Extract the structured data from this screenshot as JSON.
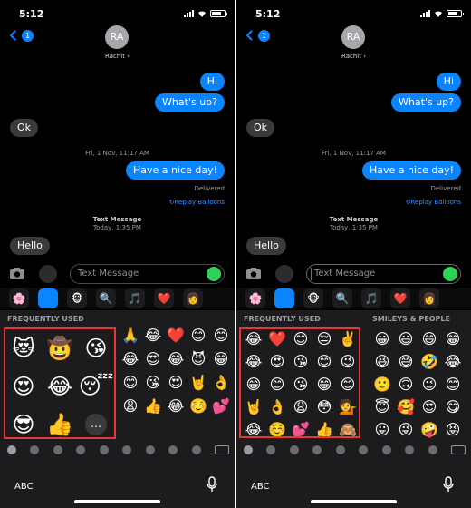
{
  "panels": [
    {
      "status": {
        "time": "5:12"
      },
      "header": {
        "back_badge": "1",
        "avatar_initials": "RA",
        "contact_name": "Rachit ›"
      },
      "messages": {
        "hi": "Hi",
        "whats_up": "What's up?",
        "ok": "Ok",
        "timestamp_1": "Fri, 1 Nov, 11:17 AM",
        "have_nice_day": "Have a nice day!",
        "delivered": "Delivered",
        "replay": "↻Replay Balloons",
        "text_message_label": "Text Message",
        "timestamp_2": "Today, 1:35 PM",
        "hello": "Hello"
      },
      "input": {
        "placeholder": "Text Message"
      },
      "keyboard": {
        "section_1": "FREQUENTLY USED",
        "abc": "ABC",
        "memoji_grid": [
          "😻",
          "🤠",
          "😘",
          "😍",
          "😂",
          "😴",
          "😎",
          "👍",
          "…"
        ],
        "emoji_grid": [
          "🙏",
          "😂",
          "❤️",
          "😊",
          "😊",
          "😂",
          "😍",
          "😂",
          "😈",
          "😁",
          "😊",
          "😘",
          "😍",
          "🤘",
          "👌",
          "😩",
          "👍",
          "😂",
          "☺️",
          "💕"
        ]
      }
    },
    {
      "status": {
        "time": "5:12"
      },
      "header": {
        "back_badge": "1",
        "avatar_initials": "RA",
        "contact_name": "Rachit ›"
      },
      "messages": {
        "hi": "Hi",
        "whats_up": "What's up?",
        "ok": "Ok",
        "timestamp_1": "Fri, 1 Nov, 11:17 AM",
        "have_nice_day": "Have a nice day!",
        "delivered": "Delivered",
        "replay": "↻Replay Balloons",
        "text_message_label": "Text Message",
        "timestamp_2": "Today, 1:35 PM",
        "hello": "Hello"
      },
      "input": {
        "placeholder": "Text Message"
      },
      "keyboard": {
        "section_1": "FREQUENTLY USED",
        "section_2": "SMILEYS & PEOPLE",
        "abc": "ABC",
        "frequent_grid": [
          "😂",
          "❤️",
          "😊",
          "😔",
          "✌️",
          "😂",
          "😍",
          "😘",
          "😊",
          "😉",
          "😁",
          "😊",
          "😘",
          "😁",
          "😊",
          "🤘",
          "👌",
          "😩",
          "😳",
          "💁",
          "😂",
          "☺️",
          "💕",
          "👍",
          "🙈"
        ],
        "smileys_grid": [
          "😀",
          "😃",
          "😄",
          "😁",
          "😆",
          "😅",
          "🤣",
          "😂",
          "🙂",
          "🙃",
          "😉",
          "😊",
          "😇",
          "🥰",
          "😍",
          "😋",
          "😛",
          "😜",
          "🤪",
          "😝"
        ]
      }
    }
  ],
  "colors": {
    "accent": "#0a84ff",
    "highlight": "#e53935",
    "send": "#30d158"
  }
}
